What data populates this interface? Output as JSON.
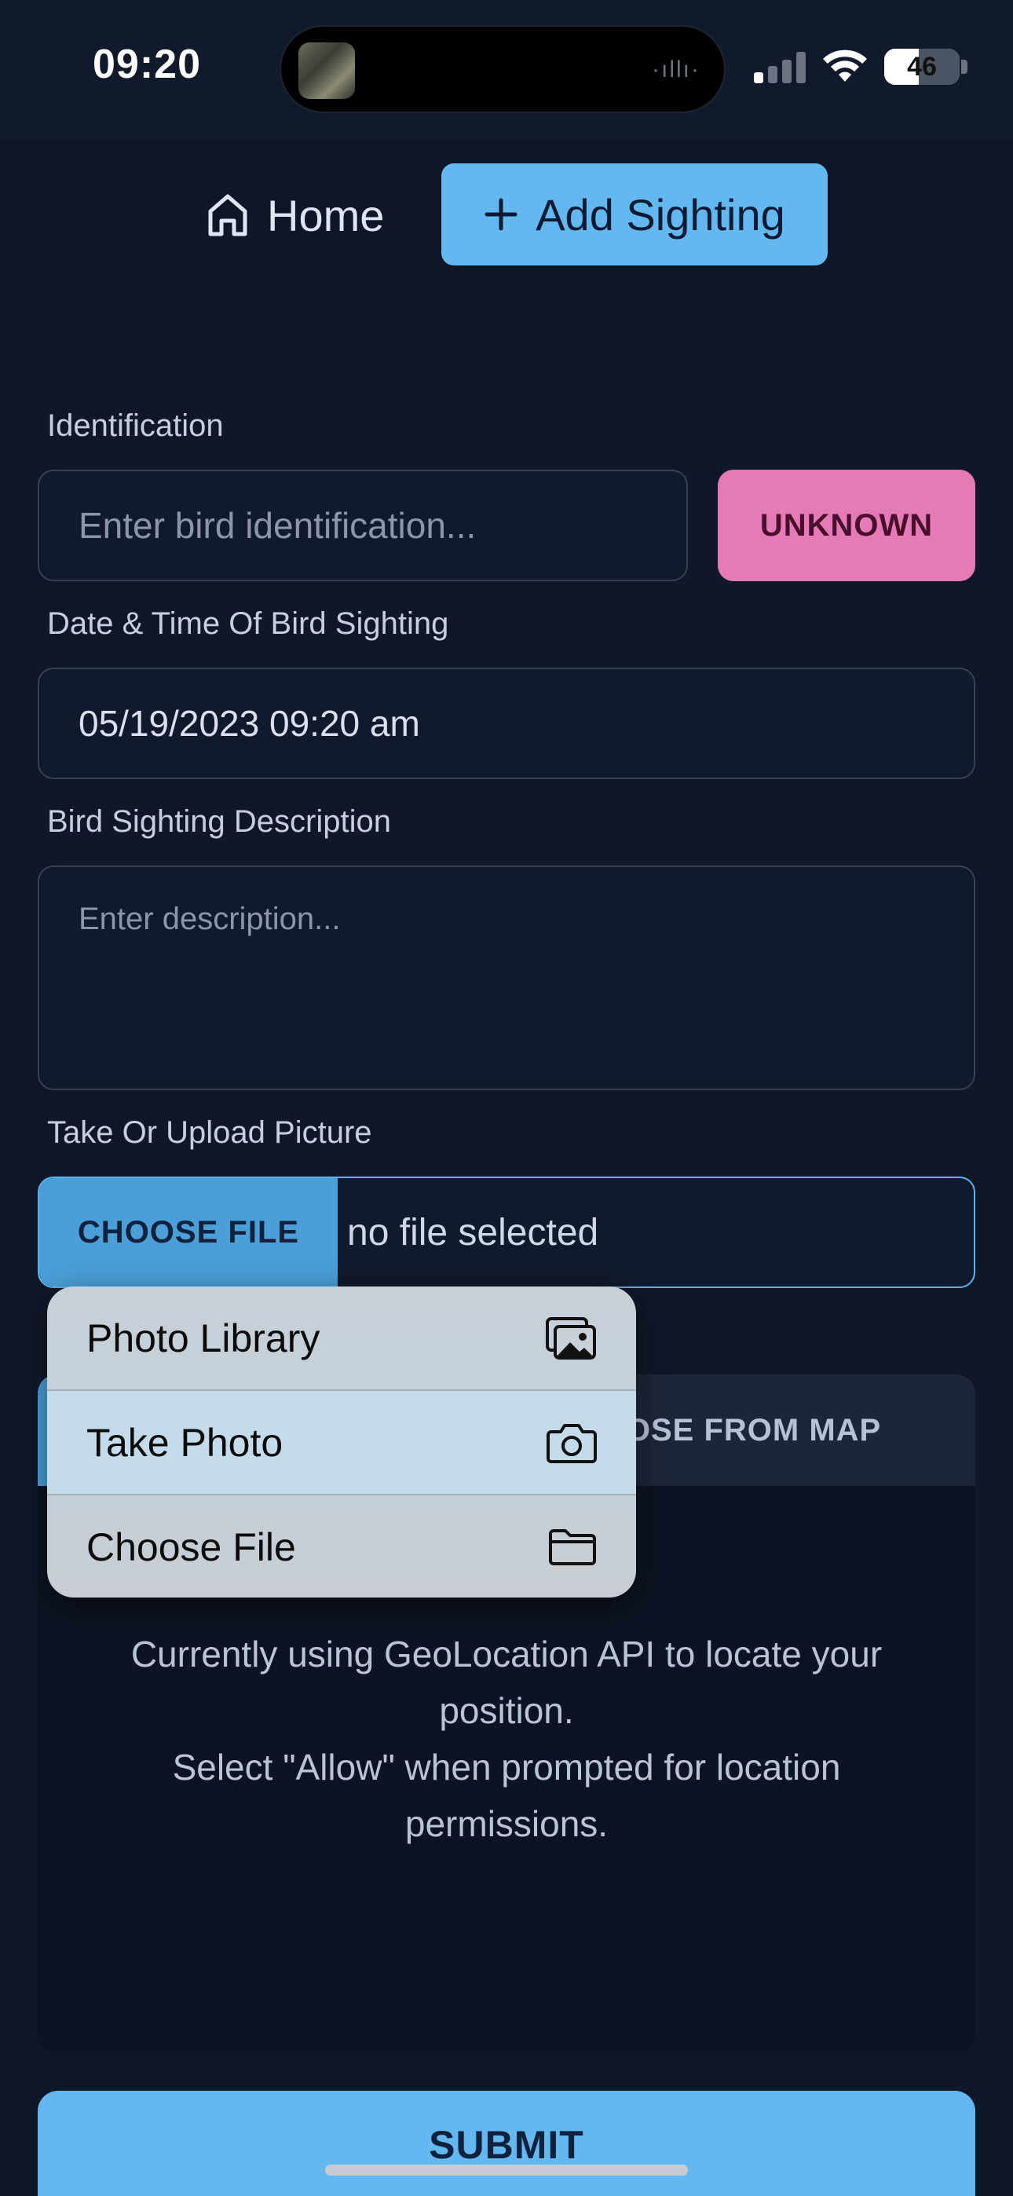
{
  "status_bar": {
    "time": "09:20",
    "battery": "46",
    "battery_level": 0.46
  },
  "nav": {
    "home_label": "Home",
    "add_sighting_label": "Add Sighting"
  },
  "form": {
    "identification_label": "Identification",
    "identification_placeholder": "Enter bird identification...",
    "unknown_button": "UNKNOWN",
    "datetime_label": "Date & Time Of Bird Sighting",
    "datetime_value": "05/19/2023 09:20 am",
    "description_label": "Bird Sighting Description",
    "description_placeholder": "Enter description...",
    "picture_label": "Take Or Upload Picture",
    "choose_file_button": "CHOOSE FILE",
    "file_status": "no file selected"
  },
  "location": {
    "map_tab_label": "OOSE FROM MAP",
    "geolocation_text": "Currently using GeoLocation API to locate your position.",
    "permission_text": "Select \"Allow\" when prompted for location permissions."
  },
  "file_menu": {
    "items": [
      {
        "label": "Photo Library",
        "icon": "photo-library-icon"
      },
      {
        "label": "Take Photo",
        "icon": "camera-icon"
      },
      {
        "label": "Choose File",
        "icon": "folder-icon"
      }
    ]
  },
  "submit_label": "SUBMIT",
  "colors": {
    "background": "#101828",
    "accent": "#63b8f0",
    "unknown_button": "#e57bb6"
  }
}
